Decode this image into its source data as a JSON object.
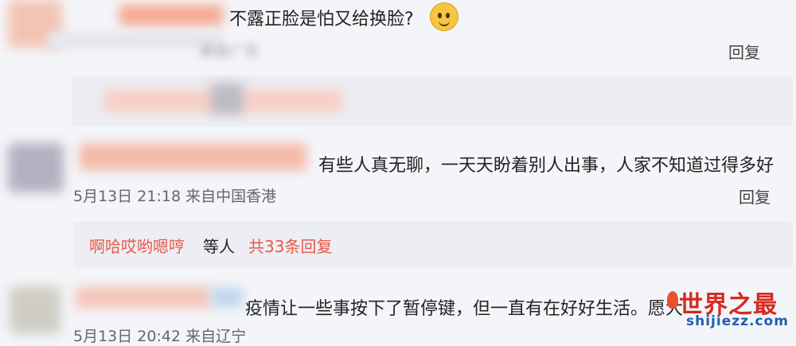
{
  "comments": [
    {
      "text": "不露正脸是怕又给换脸?",
      "meta": "来自广东",
      "reply_label": "回复"
    },
    {
      "text": "有些人真无聊，一天天盼着别人出事，人家不知道过得多好",
      "meta": "5月13日 21:18 来自中国香港",
      "reply_label": "回复",
      "thread": {
        "names": "啊哈哎哟嗯哼",
        "middle": "等人",
        "count": "共33条回复"
      }
    },
    {
      "text": "疫情让一些事按下了暂停键，但一直有在好好生活。愿大",
      "meta": "5月13日 20:42 来自辽宁",
      "reply_label": ""
    }
  ],
  "colors": {
    "background": "#f4f5f9",
    "reply_box": "#eceef3",
    "link_red": "#e8584a"
  },
  "icons": {
    "emoji": "dog-face-emoji-icon",
    "logo": "fire-logo-icon"
  },
  "watermark": {
    "main": "世界之最",
    "sub": "shijiezz.com"
  }
}
